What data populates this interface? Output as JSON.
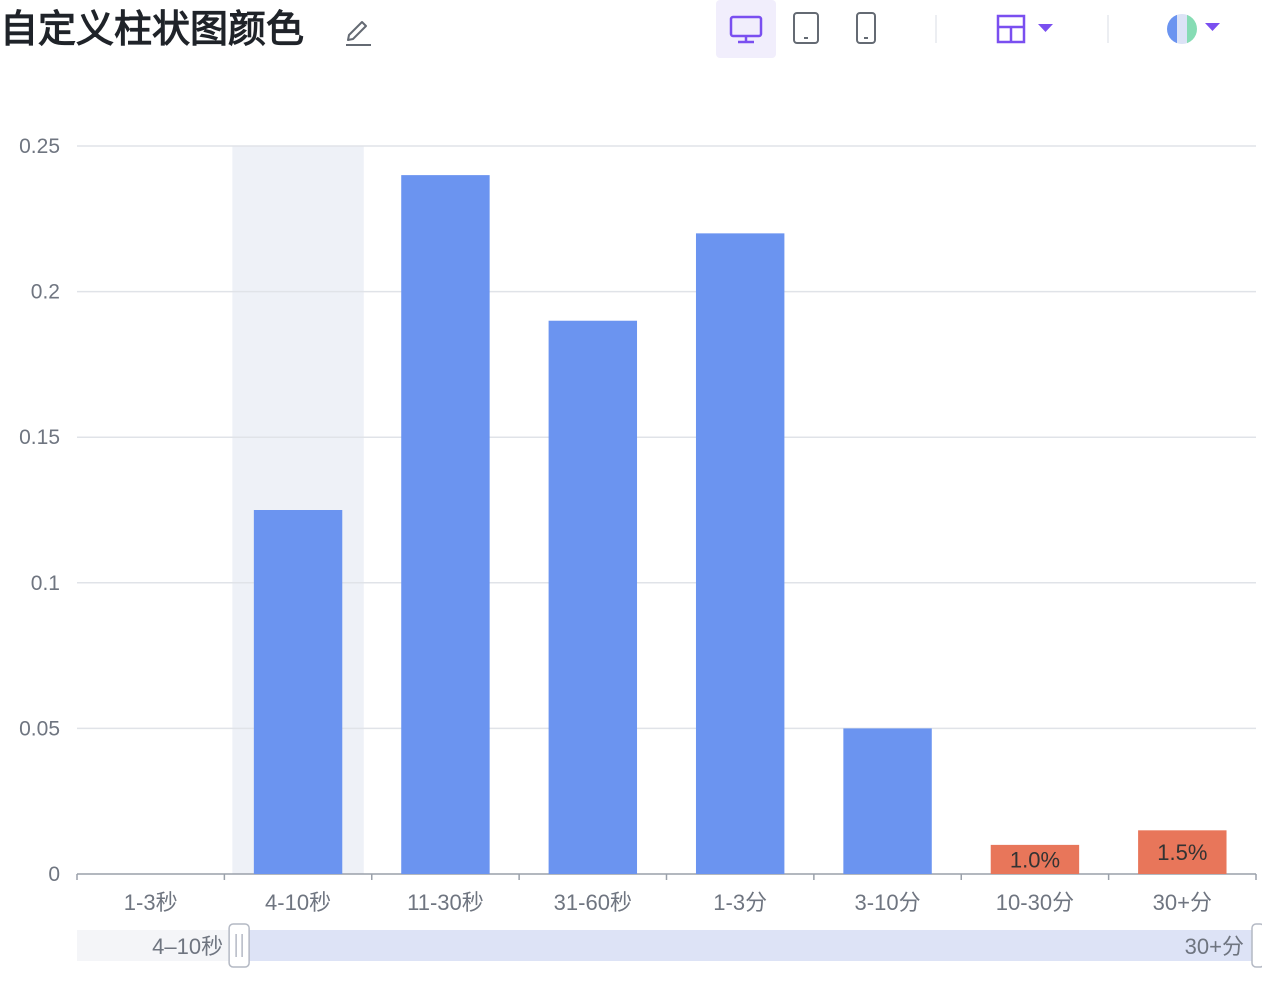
{
  "header": {
    "title": "自定义柱状图颜色",
    "edit_icon": "pencil-icon",
    "device_buttons": [
      {
        "name": "desktop",
        "icon": "monitor-icon",
        "active": true
      },
      {
        "name": "tablet",
        "icon": "tablet-icon",
        "active": false
      },
      {
        "name": "mobile",
        "icon": "phone-icon",
        "active": false
      }
    ],
    "layout_icon": "layout-icon",
    "theme_icon": "theme-circle-icon",
    "accent_color": "#7a4ff0"
  },
  "chart_data": {
    "type": "bar",
    "title": "",
    "xlabel": "",
    "ylabel": "",
    "categories": [
      "1-3秒",
      "4-10秒",
      "11-30秒",
      "31-60秒",
      "1-3分",
      "3-10分",
      "10-30分",
      "30+分"
    ],
    "values": [
      0,
      0.125,
      0.24,
      0.19,
      0.22,
      0.05,
      0.01,
      0.015
    ],
    "ylim": [
      0,
      0.25
    ],
    "yticks": [
      "0",
      "0.05",
      "0.1",
      "0.15",
      "0.2",
      "0.25"
    ],
    "grid": true,
    "default_color": "#6b94f0",
    "highlight_color": "#e8765a",
    "highlighted_categories": [
      "10-30分",
      "30+分"
    ],
    "data_labels": [
      {
        "category": "10-30分",
        "text": "1.0%"
      },
      {
        "category": "30+分",
        "text": "1.5%"
      }
    ],
    "hovered_category": "4-10秒",
    "datazoom": {
      "start_label": "4–10秒",
      "end_label": "30+分"
    }
  }
}
